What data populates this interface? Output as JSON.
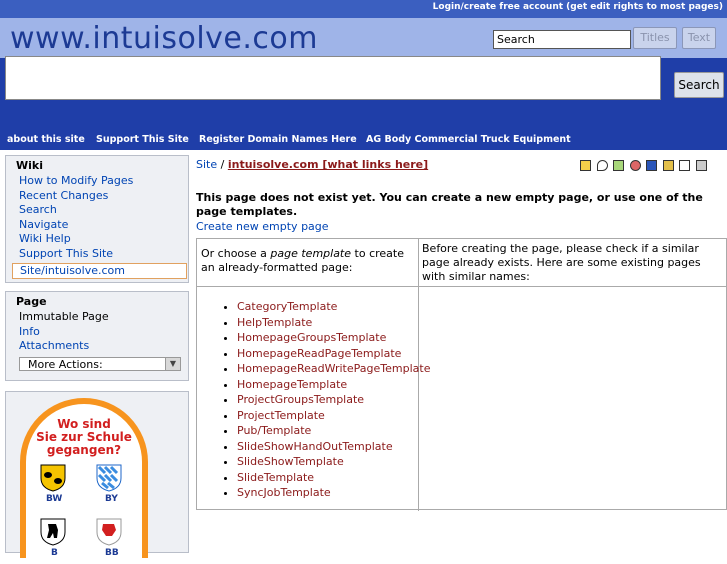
{
  "header": {
    "login_link": "Login/create free account (get edit rights to most pages)",
    "site_title": "www.intuisolve.com",
    "search_value": "Search",
    "titles_button": "Titles",
    "text_button": "Text",
    "big_search_button": "Search"
  },
  "nav": [
    "about this site",
    "Support This Site",
    "Register Domain Names Here",
    "AG Body Commercial Truck Equipment"
  ],
  "sidebar": {
    "wiki": {
      "title": "Wiki",
      "items": [
        "How to Modify Pages",
        "Recent Changes",
        "Search",
        "Navigate",
        "Wiki Help",
        "Support This Site"
      ],
      "current": "Site/intuisolve.com"
    },
    "page": {
      "title": "Page",
      "immutable": "Immutable Page",
      "items": [
        "Info",
        "Attachments"
      ],
      "more_actions": "More Actions:"
    },
    "ad": {
      "line1": "Wo sind",
      "line2": "Sie zur Schule",
      "line3": "gegangen?",
      "labels": [
        "BW",
        "BY",
        "B",
        "BB"
      ]
    }
  },
  "main": {
    "breadcrumb_parent": "Site",
    "breadcrumb_sep": "/",
    "breadcrumb_current": "intuisolve.com [what links here]",
    "icons": [
      "up-icon",
      "comment-icon",
      "edit-icon",
      "diff-icon",
      "info-icon",
      "subscribe-icon",
      "raw-icon",
      "print-icon"
    ],
    "heading": "This page does not exist yet. You can create a new empty page, or use one of the page templates.",
    "create_link": "Create new empty page",
    "choose_pre": "Or choose a ",
    "choose_em": "page template",
    "choose_post": " to create an already-formatted page:",
    "similar_text": "Before creating the page, please check if a similar page already exists. Here are some existing pages with similar names:",
    "templates": [
      "CategoryTemplate",
      "HelpTemplate",
      "HomepageGroupsTemplate",
      "HomepageReadPageTemplate",
      "HomepageReadWritePageTemplate",
      "HomepageTemplate",
      "ProjectGroupsTemplate",
      "ProjectTemplate",
      "Pub/Template",
      "SlideShowHandOutTemplate",
      "SlideShowTemplate",
      "SlideTemplate",
      "SyncJobTemplate"
    ]
  }
}
